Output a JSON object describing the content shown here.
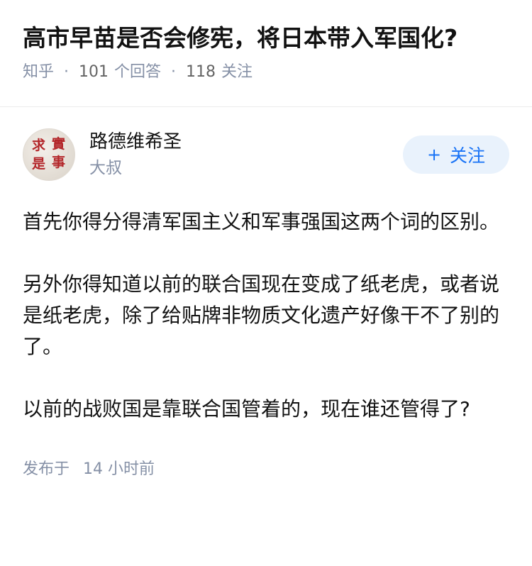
{
  "question": {
    "title": "高市早苗是否会修宪，将日本带入军国化?",
    "source": "知乎",
    "answer_count": "101",
    "answer_label": "个回答",
    "follower_count": "118",
    "follower_label": "关注"
  },
  "author": {
    "name": "路德维希圣",
    "bio": "大叔",
    "avatar_text": [
      "求",
      "實",
      "是",
      "事"
    ],
    "follow_label": "关注",
    "follow_icon": "plus-icon"
  },
  "answer": {
    "paragraphs": [
      "首先你得分得清军国主义和军事强国这两个词的区别。",
      "另外你得知道以前的联合国现在变成了纸老虎，或者说是纸老虎，除了给贴牌非物质文化遗产好像干不了别的了。",
      "以前的战败国是靠联合国管着的，现在谁还管得了?"
    ],
    "published_label": "发布于",
    "published_time": "14 小时前"
  },
  "colors": {
    "accent": "#1772f6",
    "follow_bg": "#e9f2fc",
    "meta_text": "#8590a6",
    "seal_red": "#b3262a"
  }
}
